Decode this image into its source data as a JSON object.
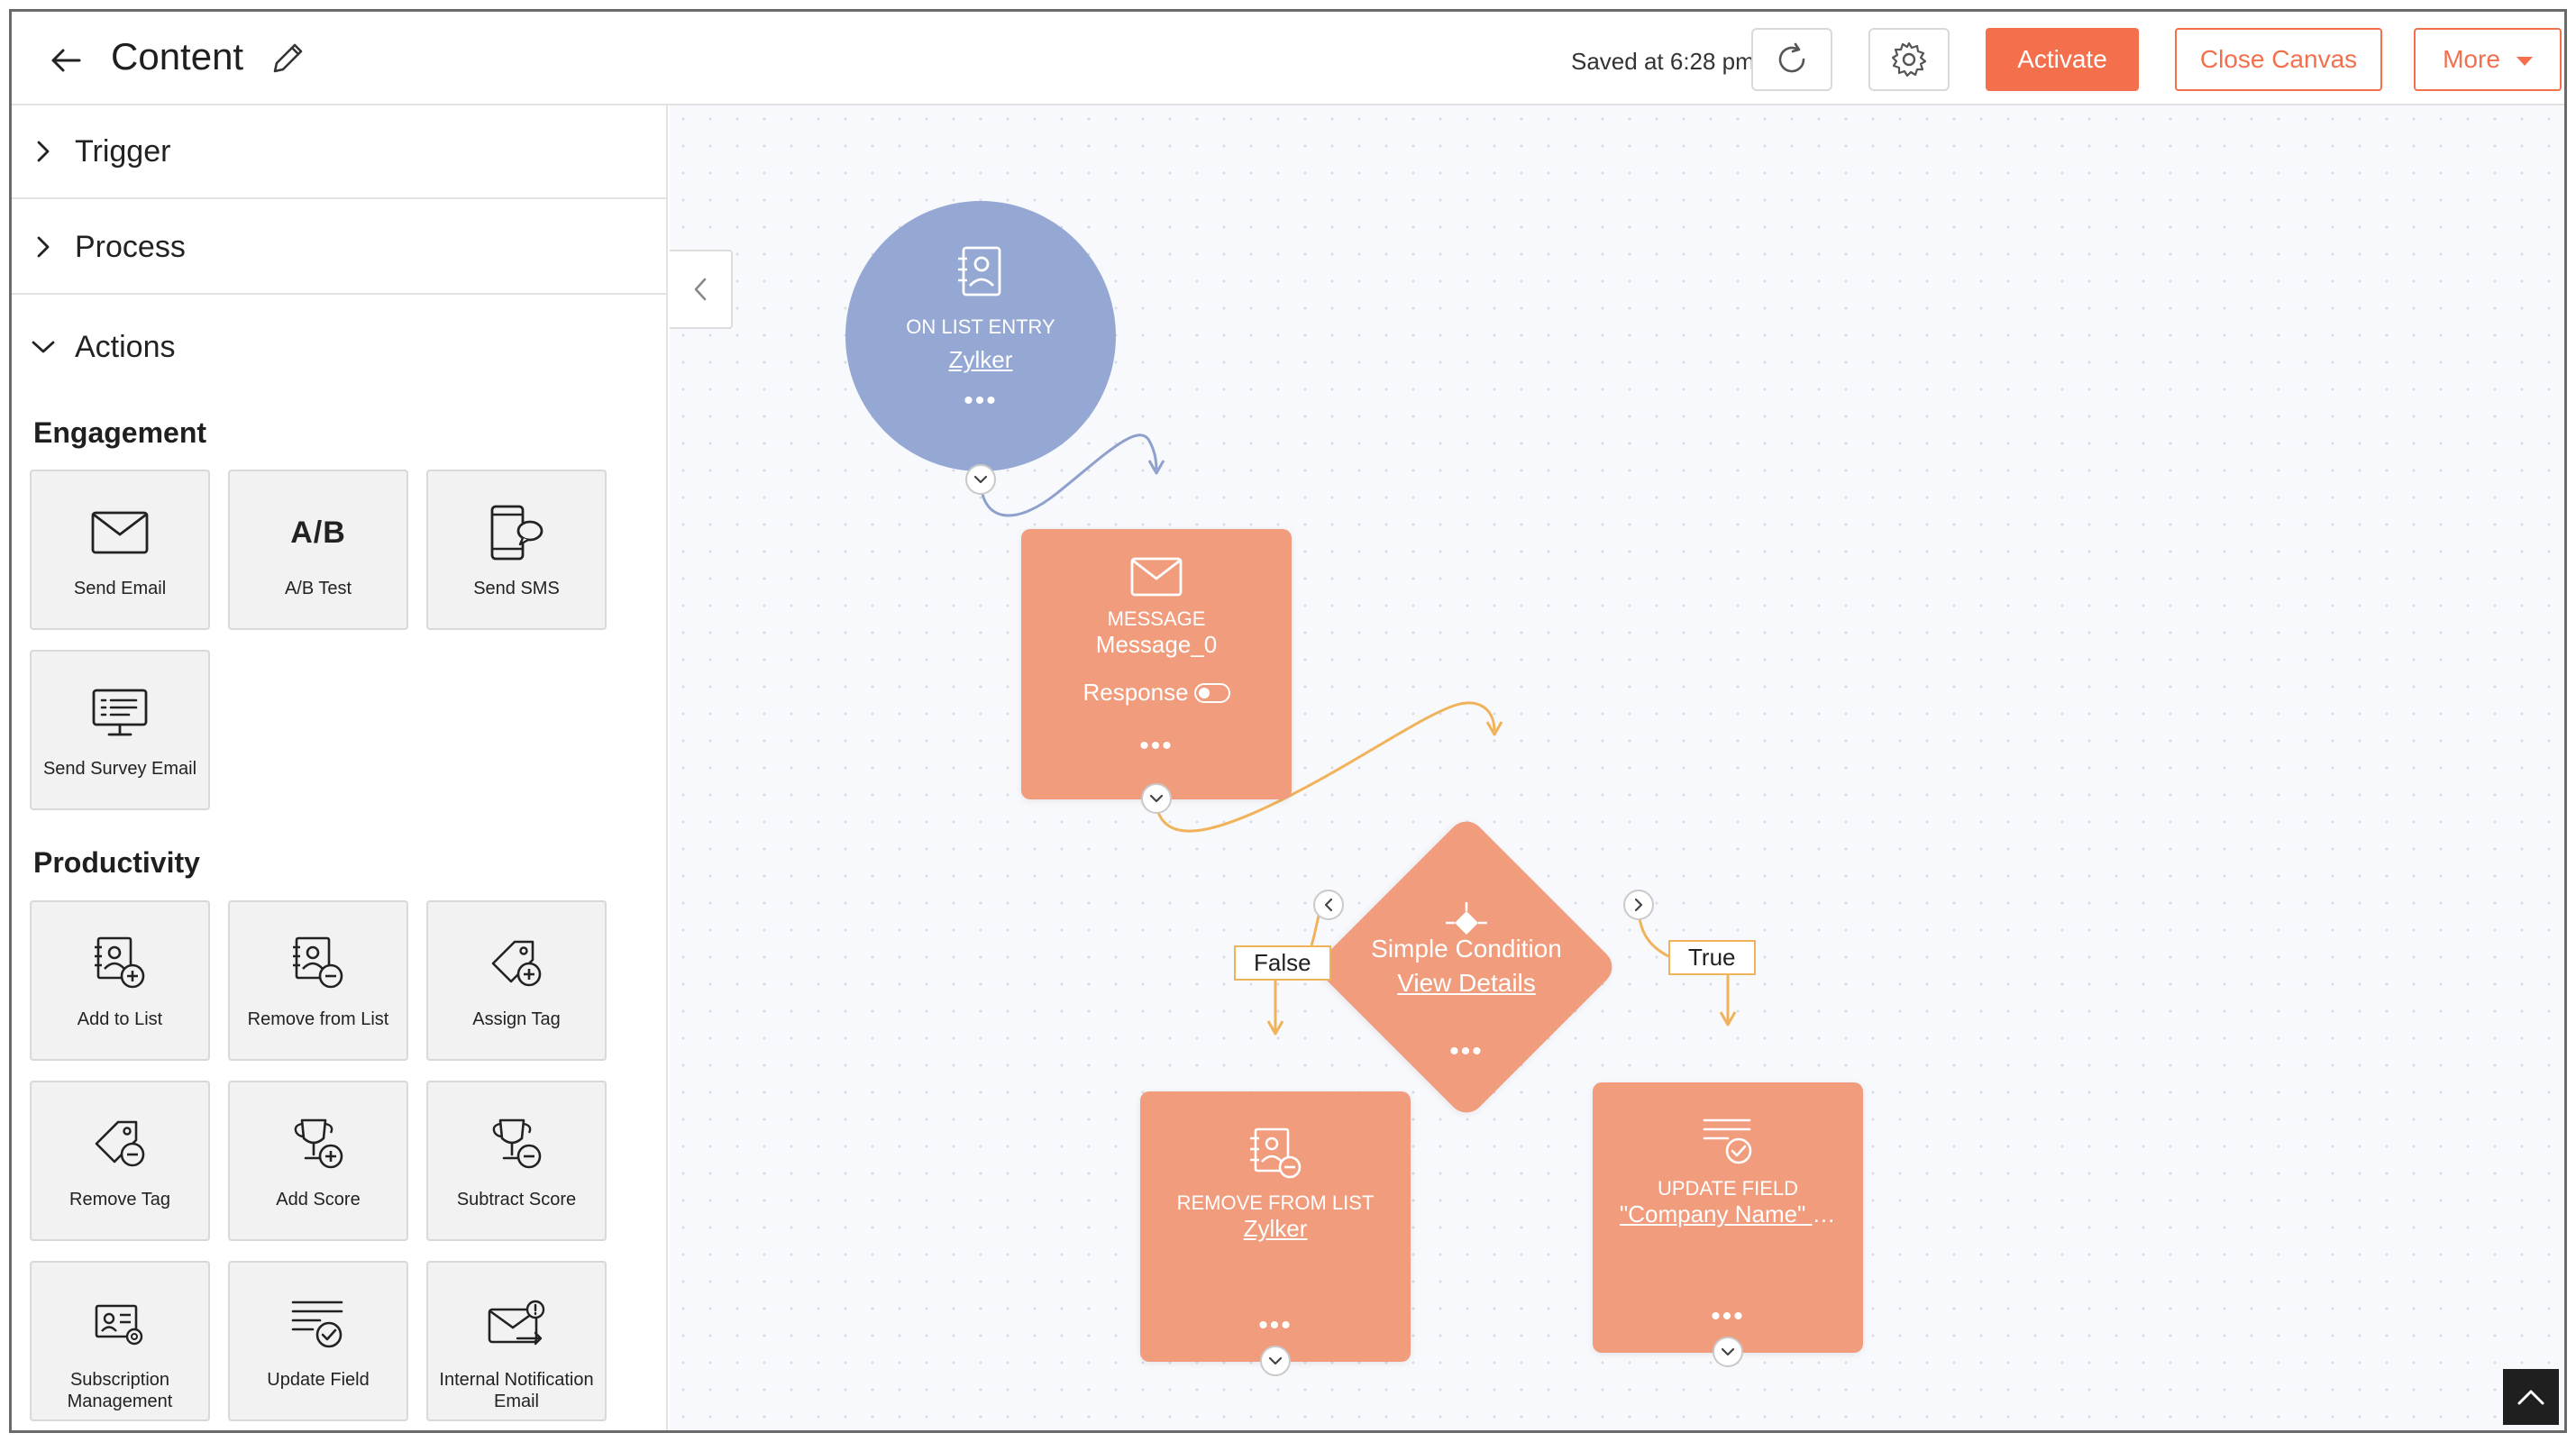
{
  "header": {
    "title": "Content",
    "saved_text": "Saved at 6:28 pm",
    "activate_label": "Activate",
    "close_label": "Close Canvas",
    "more_label": "More"
  },
  "sidebar": {
    "sections": {
      "trigger": "Trigger",
      "process": "Process",
      "actions": "Actions"
    },
    "engagement": {
      "title": "Engagement",
      "items": [
        {
          "label": "Send Email",
          "icon": "envelope-icon"
        },
        {
          "label": "A/B Test",
          "icon": "ab-test-icon",
          "glyph": "A/B"
        },
        {
          "label": "Send SMS",
          "icon": "mobile-sms-icon"
        },
        {
          "label": "Send Survey Email",
          "icon": "survey-monitor-icon"
        }
      ]
    },
    "productivity": {
      "title": "Productivity",
      "items": [
        {
          "label": "Add to List",
          "icon": "contact-add-icon"
        },
        {
          "label": "Remove from List",
          "icon": "contact-remove-icon"
        },
        {
          "label": "Assign Tag",
          "icon": "tag-add-icon"
        },
        {
          "label": "Remove Tag",
          "icon": "tag-remove-icon"
        },
        {
          "label": "Add Score",
          "icon": "trophy-add-icon"
        },
        {
          "label": "Subtract Score",
          "icon": "trophy-remove-icon"
        },
        {
          "label": "Subscription Management",
          "icon": "subscription-card-icon"
        },
        {
          "label": "Update Field",
          "icon": "update-field-icon"
        },
        {
          "label": "Internal Notification Email",
          "icon": "notification-email-icon"
        }
      ]
    }
  },
  "canvas": {
    "trigger_node": {
      "type": "ON LIST ENTRY",
      "link": "Zylker"
    },
    "message_node": {
      "type": "MESSAGE",
      "name": "Message_0",
      "response_label": "Response"
    },
    "condition_node": {
      "name": "Simple Condition",
      "link": "View Details",
      "false_label": "False",
      "true_label": "True"
    },
    "remove_node": {
      "type": "REMOVE FROM LIST",
      "link": "Zylker"
    },
    "update_node": {
      "type": "UPDATE FIELD",
      "link": "\"Company Name\" t..."
    },
    "more_dots": "•••"
  },
  "colors": {
    "accent": "#f46f4c",
    "trigger_node": "#94a8d3",
    "action_node": "#f09c7d",
    "connector_trigger": "#8ea1cc",
    "connector_action": "#f0b25a"
  }
}
